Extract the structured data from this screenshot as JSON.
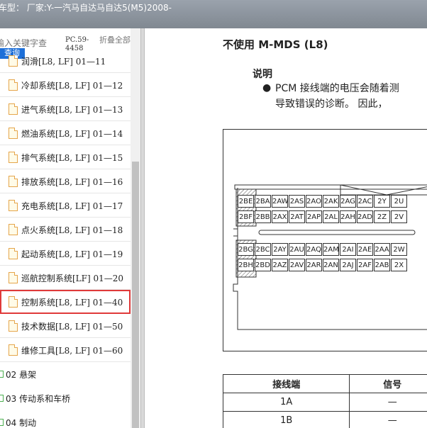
{
  "titlebar": {
    "text": "车型：  厂家:Y-一汽马自达马自达5(M5)2008-"
  },
  "left": {
    "search_placeholder": "输入关键字查",
    "search_button": "查询",
    "pc_code": "PC.59-4458",
    "collapse_all": "折叠全部",
    "items": [
      "润滑[L8, LF] 01—11",
      "冷却系统[L8, LF] 01—12",
      "进气系统[L8, LF] 01—13",
      "燃油系统[L8, LF] 01—14",
      "排气系统[L8, LF] 01—15",
      "排放系统[L8, LF] 01—16",
      "充电系统[L8, LF] 01—17",
      "点火系统[L8, LF] 01—18",
      "起动系统[L8, LF] 01—19",
      "巡航控制系统[LF] 01—20",
      "控制系统[L8, LF] 01—40",
      "技术数据[L8, LF] 01—50",
      "维修工具[L8, LF] 01—60"
    ],
    "folders": [
      "02 悬架",
      "03 传动系和车桥",
      "04 制动"
    ]
  },
  "doc": {
    "heading": "不使用 M-MDS (L8)",
    "sub": "说明",
    "note_line1": "PCM 接线端的电压会随着测",
    "note_line2": "导致错误的诊断。 因此，",
    "connector_rows": [
      [
        "2BE",
        "2BA",
        "2AW",
        "2AS",
        "2AO",
        "2AK",
        "2AG",
        "2AC",
        "2Y",
        "2U"
      ],
      [
        "2BF",
        "2BB",
        "2AX",
        "2AT",
        "2AP",
        "2AL",
        "2AH",
        "2AD",
        "2Z",
        "2V"
      ],
      [
        "2BG",
        "2BC",
        "2AY",
        "2AU",
        "2AQ",
        "2AM",
        "2AI",
        "2AE",
        "2AA",
        "2W"
      ],
      [
        "2BH",
        "2BD",
        "2AZ",
        "2AV",
        "2AR",
        "2AN",
        "2AJ",
        "2AF",
        "2AB",
        "2X"
      ]
    ],
    "table": {
      "headers": [
        "接线端",
        "信号"
      ],
      "rows": [
        [
          "1A",
          "—"
        ],
        [
          "1B",
          "—"
        ]
      ]
    }
  }
}
